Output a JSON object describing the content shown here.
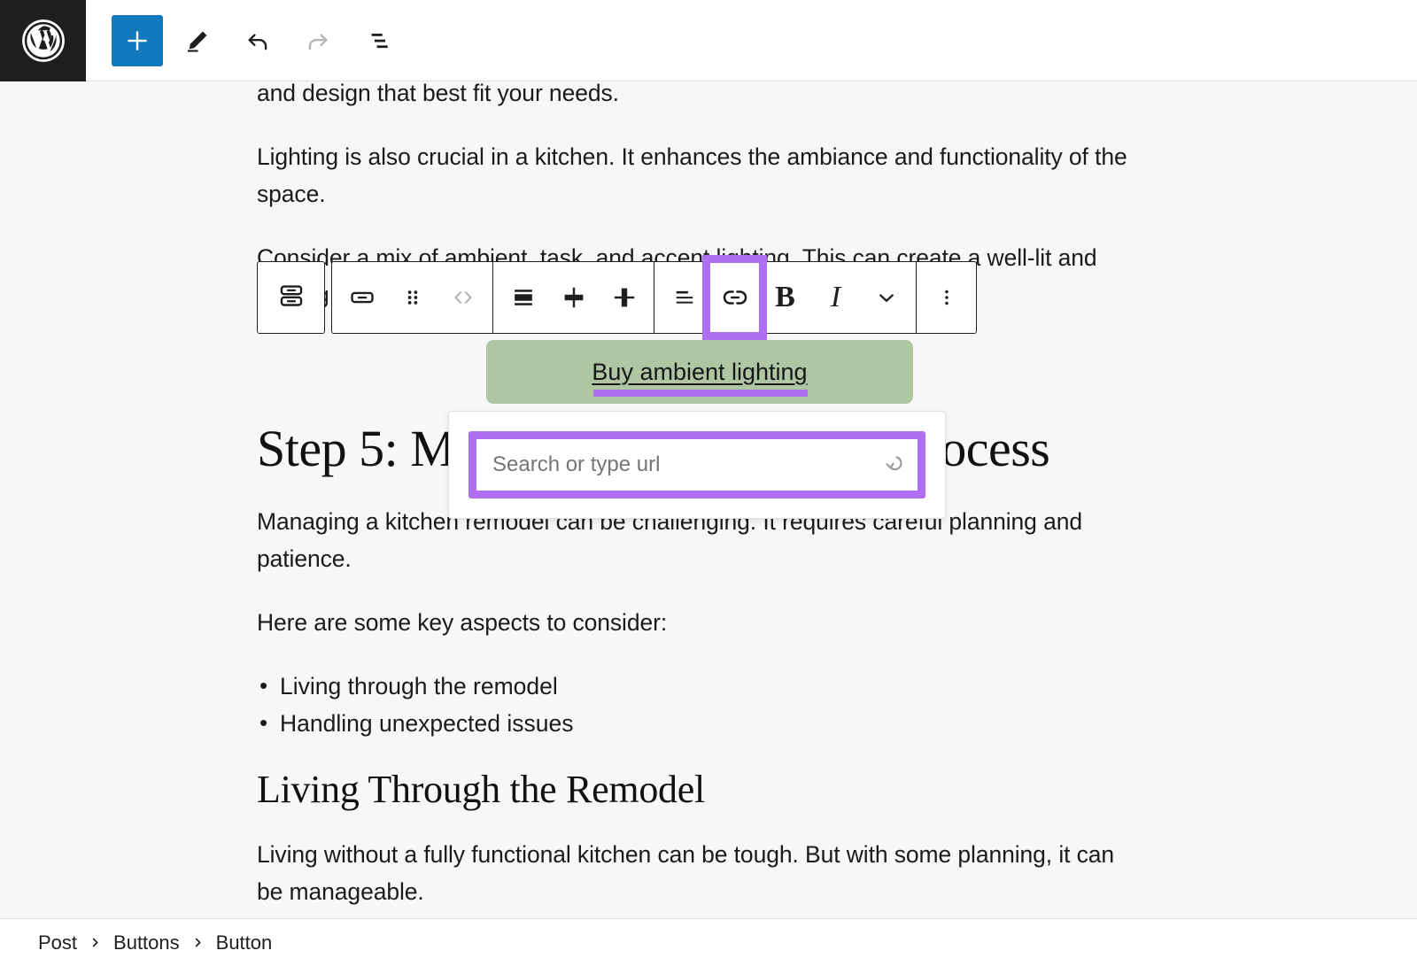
{
  "header": {
    "logo_icon": "wordpress-logo-icon",
    "tools": [
      {
        "name": "add-block-button",
        "icon": "plus-icon",
        "label": "Add block",
        "primary": true,
        "disabled": false
      },
      {
        "name": "edit-tool-button",
        "icon": "pencil-icon",
        "label": "Edit",
        "primary": false,
        "disabled": false
      },
      {
        "name": "undo-button",
        "icon": "undo-icon",
        "label": "Undo",
        "primary": false,
        "disabled": false
      },
      {
        "name": "redo-button",
        "icon": "redo-icon",
        "label": "Redo",
        "primary": false,
        "disabled": true
      },
      {
        "name": "list-view-button",
        "icon": "list-view-icon",
        "label": "List view",
        "primary": false,
        "disabled": false
      }
    ]
  },
  "toolbar": {
    "parent_button": {
      "name": "select-parent-buttons-block",
      "icon": "buttons-block-icon",
      "label": "Select Buttons"
    },
    "groups": [
      {
        "name": "block-and-move-group",
        "items": [
          {
            "name": "block-type-button",
            "icon": "button-block-icon",
            "label": "Button",
            "highlighted": false,
            "disabled": false
          },
          {
            "name": "drag-handle",
            "icon": "drag-dots-icon",
            "label": "Drag",
            "highlighted": false,
            "disabled": false
          },
          {
            "name": "move-arrows-button",
            "icon": "move-chevrons-icon",
            "label": "Move",
            "highlighted": false,
            "disabled": true
          }
        ]
      },
      {
        "name": "width-group",
        "items": [
          {
            "name": "fill-width-button",
            "icon": "align-fill-icon",
            "label": "Fill width",
            "highlighted": false,
            "disabled": false
          },
          {
            "name": "fit-width-button",
            "icon": "align-center-h-icon",
            "label": "Fit width",
            "highlighted": false,
            "disabled": false
          },
          {
            "name": "fixed-width-button",
            "icon": "align-center-v-icon",
            "label": "Fixed width",
            "highlighted": false,
            "disabled": false
          }
        ]
      },
      {
        "name": "format-group",
        "items": [
          {
            "name": "align-text-button",
            "icon": "align-left-icon",
            "label": "Align text",
            "highlighted": false,
            "disabled": false
          },
          {
            "name": "link-button",
            "icon": "link-icon",
            "label": "Link",
            "highlighted": true,
            "disabled": false
          },
          {
            "name": "bold-button",
            "icon": "bold-icon",
            "label": "Bold",
            "highlighted": false,
            "disabled": false
          },
          {
            "name": "italic-button",
            "icon": "italic-icon",
            "label": "Italic",
            "highlighted": false,
            "disabled": false
          },
          {
            "name": "more-formats-button",
            "icon": "chevron-down-icon",
            "label": "More",
            "highlighted": false,
            "disabled": false
          }
        ]
      },
      {
        "name": "options-group",
        "items": [
          {
            "name": "block-options-button",
            "icon": "vertical-dots-icon",
            "label": "Options",
            "highlighted": false,
            "disabled": false
          }
        ]
      }
    ]
  },
  "content": {
    "paragraph_1": "and design that best fit your needs.",
    "paragraph_2": "Lighting is also crucial in a kitchen. It enhances the ambiance and functionality of the space.",
    "paragraph_3": "Consider a mix of ambient, task, and accent lighting. This can create a well-lit and inviting space.",
    "button_label": "Buy ambient lighting",
    "heading_step5": "Step 5: Managing the Remodel Process",
    "paragraph_4": "Managing a kitchen remodel can be challenging. It requires careful planning and patience.",
    "paragraph_5": "Here are some key aspects to consider:",
    "bullets": [
      "Living through the remodel",
      "Handling unexpected issues"
    ],
    "heading_living": "Living Through the Remodel",
    "paragraph_6": "Living without a fully functional kitchen can be tough. But with some planning, it can be manageable."
  },
  "link_popover": {
    "name": "link-popover",
    "placeholder": "Search or type url",
    "value": "",
    "submit_icon": "enter-arrow-icon"
  },
  "breadcrumb": {
    "items": [
      "Post",
      "Buttons",
      "Button"
    ],
    "separator_icon": "chevron-right-icon"
  },
  "colors": {
    "highlight_purple": "#b06ef2",
    "button_green": "#b0c5a1",
    "primary_blue": "#1279be",
    "canvas_bg": "#f7f7f7",
    "logo_bg": "#1e1e1e"
  }
}
